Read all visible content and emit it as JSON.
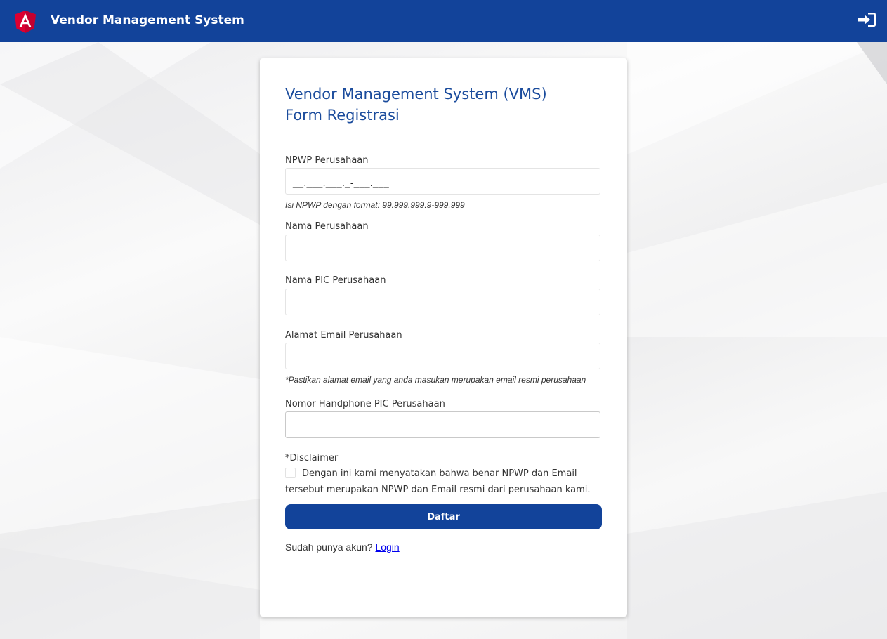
{
  "navbar": {
    "brand": "Vendor Management System",
    "logo_icon": "angular-logo-icon",
    "login_icon": "sign-in-icon",
    "background": "#12439a"
  },
  "form": {
    "title_line1": "Vendor Management System (VMS)",
    "title_line2": "Form Registrasi",
    "npwp": {
      "label": "NPWP Perusahaan",
      "mask": "__.___.___._-___.___",
      "hint": "Isi NPWP dengan format: 99.999.999.9-999.999"
    },
    "company_name": {
      "label": "Nama Perusahaan",
      "value": ""
    },
    "pic_name": {
      "label": "Nama PIC Perusahaan",
      "value": ""
    },
    "email": {
      "label": "Alamat Email Perusahaan",
      "value": "",
      "hint": "*Pastikan alamat email yang anda masukan merupakan email resmi perusahaan"
    },
    "phone": {
      "label": "Nomor Handphone PIC Perusahaan",
      "value": ""
    },
    "disclaimer": {
      "label": "*Disclaimer",
      "text": "Dengan ini kami menyatakan bahwa benar NPWP dan Email tersebut merupakan NPWP dan Email resmi dari perusahaan kami.",
      "checked": false
    },
    "submit_label": "Daftar",
    "footer_prompt": "Sudah punya akun? ",
    "login_link": "Login"
  },
  "accent_color": "#12439a"
}
